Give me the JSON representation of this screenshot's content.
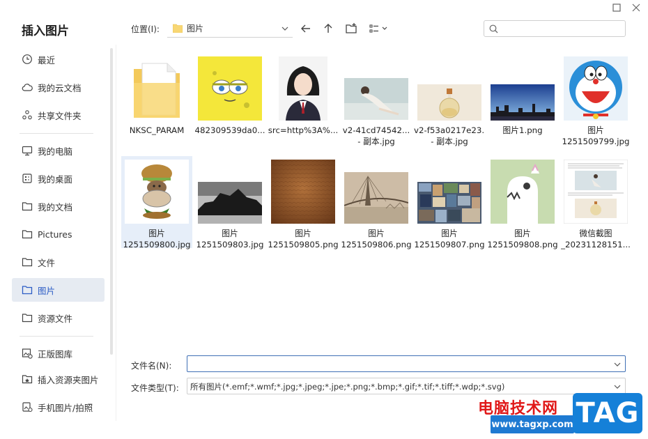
{
  "dialog": {
    "title": "插入图片"
  },
  "sidebar": {
    "items": [
      {
        "label": "最近",
        "icon": "clock-icon"
      },
      {
        "label": "我的云文档",
        "icon": "cloud-icon"
      },
      {
        "label": "共享文件夹",
        "icon": "share-icon"
      },
      {
        "label": "我的电脑",
        "icon": "monitor-icon"
      },
      {
        "label": "我的桌面",
        "icon": "desktop-icon"
      },
      {
        "label": "我的文档",
        "icon": "folder-icon"
      },
      {
        "label": "Pictures",
        "icon": "folder-icon"
      },
      {
        "label": "文件",
        "icon": "folder-icon"
      },
      {
        "label": "图片",
        "icon": "folder-icon"
      },
      {
        "label": "资源文件",
        "icon": "folder-icon"
      },
      {
        "label": "正版图库",
        "icon": "gallery-icon"
      },
      {
        "label": "插入资源夹图片",
        "icon": "star-folder-icon"
      },
      {
        "label": "手机图片/拍照",
        "icon": "phone-image-icon"
      }
    ],
    "active_index": 8
  },
  "toolbar": {
    "location_label": "位置(I):",
    "location_value": "图片",
    "search_placeholder": ""
  },
  "files": [
    {
      "name": [
        "NKSC_PARAM"
      ],
      "kind": "folder"
    },
    {
      "name": [
        "482309539da0..."
      ],
      "kind": "spongebob"
    },
    {
      "name": [
        "src=http%3A%..."
      ],
      "kind": "portrait"
    },
    {
      "name": [
        "v2-41cd74542...",
        "- 副本.jpg"
      ],
      "kind": "woman"
    },
    {
      "name": [
        "v2-f53a0217e23...",
        "- 副本.jpg"
      ],
      "kind": "bottle"
    },
    {
      "name": [
        "图片1.png"
      ],
      "kind": "city"
    },
    {
      "name": [
        "图片",
        "1251509799.jpg"
      ],
      "kind": "doraemon"
    },
    {
      "name": [
        "图片",
        "1251509800.jpg"
      ],
      "kind": "burger"
    },
    {
      "name": [
        "图片",
        "1251509803.jpg"
      ],
      "kind": "rock"
    },
    {
      "name": [
        "图片",
        "1251509805.png"
      ],
      "kind": "leather"
    },
    {
      "name": [
        "图片",
        "1251509806.png"
      ],
      "kind": "bridge"
    },
    {
      "name": [
        "图片",
        "1251509807.png"
      ],
      "kind": "collage"
    },
    {
      "name": [
        "图片",
        "1251509808.png"
      ],
      "kind": "dino"
    },
    {
      "name": [
        "微信截图",
        "_20231128151..."
      ],
      "kind": "screenshot"
    }
  ],
  "selected_file_index": 7,
  "form": {
    "filename_label": "文件名(N):",
    "filename_value": "",
    "filetype_label": "文件类型(T):",
    "filetype_value": "所有图片(*.emf;*.wmf;*.jpg;*.jpeg;*.jpe;*.png;*.bmp;*.gif;*.tif;*.tiff;*.wdp;*.svg)"
  },
  "watermark": {
    "site_name": "电脑技术网",
    "url": "www.tagxp.com",
    "tag": "TAG"
  }
}
